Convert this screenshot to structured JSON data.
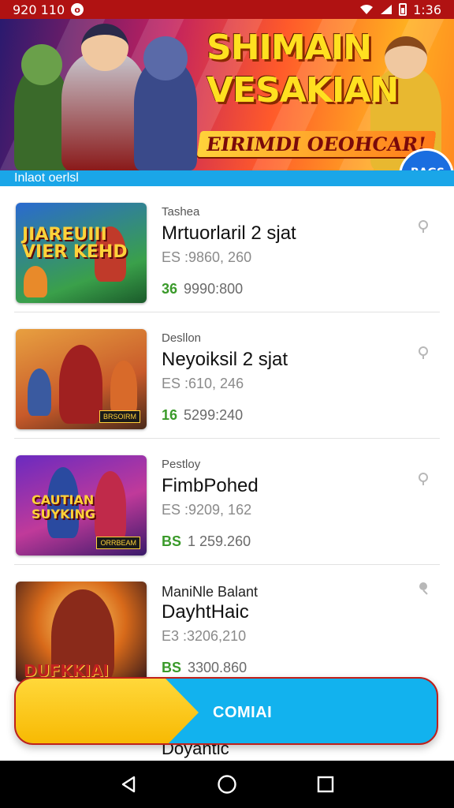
{
  "status_bar": {
    "left_text": "920 110",
    "time": "1:36"
  },
  "banner": {
    "title_line1": "SHIMAIN",
    "title_line2": "VESAKIAN",
    "subtitle": "EIRIMDI OEOHCAR!",
    "badge": "BAGS"
  },
  "section_header": {
    "label": "Inlaot oerlsl"
  },
  "games": [
    {
      "category": "Tashea",
      "name": "Mrtuorlaril 2 sjat",
      "old_price": "ES :9860, 260",
      "currency": "36",
      "new_price": "9990:800",
      "thumb_title": "JIAREUIII VIER KEHD",
      "thumb_tag": ""
    },
    {
      "category": "Desllon",
      "name": "Neyoiksil 2 sjat",
      "old_price": "ES :610, 246",
      "currency": "16",
      "new_price": "5299:240",
      "thumb_title": "",
      "thumb_tag": "BRSOIRM"
    },
    {
      "category": "Pestloy",
      "name": "FimbPohed",
      "old_price": "ES :9209, 162",
      "currency": "BS",
      "new_price": "1 259.260",
      "thumb_title": "CAUTIAN SUYKING",
      "thumb_tag": "ORRBEAM"
    },
    {
      "category": "ManiNle Balant",
      "name": "DayhtHaic",
      "old_price": "E3 :3206,210",
      "currency": "BS",
      "new_price": "3300.860",
      "thumb_title": "DUFKKIAI",
      "thumb_tag": ""
    }
  ],
  "peek_item": {
    "name": "Doyantic"
  },
  "cta": {
    "label": "COMIAI"
  },
  "colors": {
    "status_bar": "#b01212",
    "accent_blue": "#12b2ee",
    "accent_yellow": "#ffd83a",
    "price_green": "#3a9a2a"
  },
  "icons": {
    "pin": "map-pin-icon",
    "back": "back-triangle-icon",
    "home": "home-circle-icon",
    "recents": "recents-square-icon"
  }
}
